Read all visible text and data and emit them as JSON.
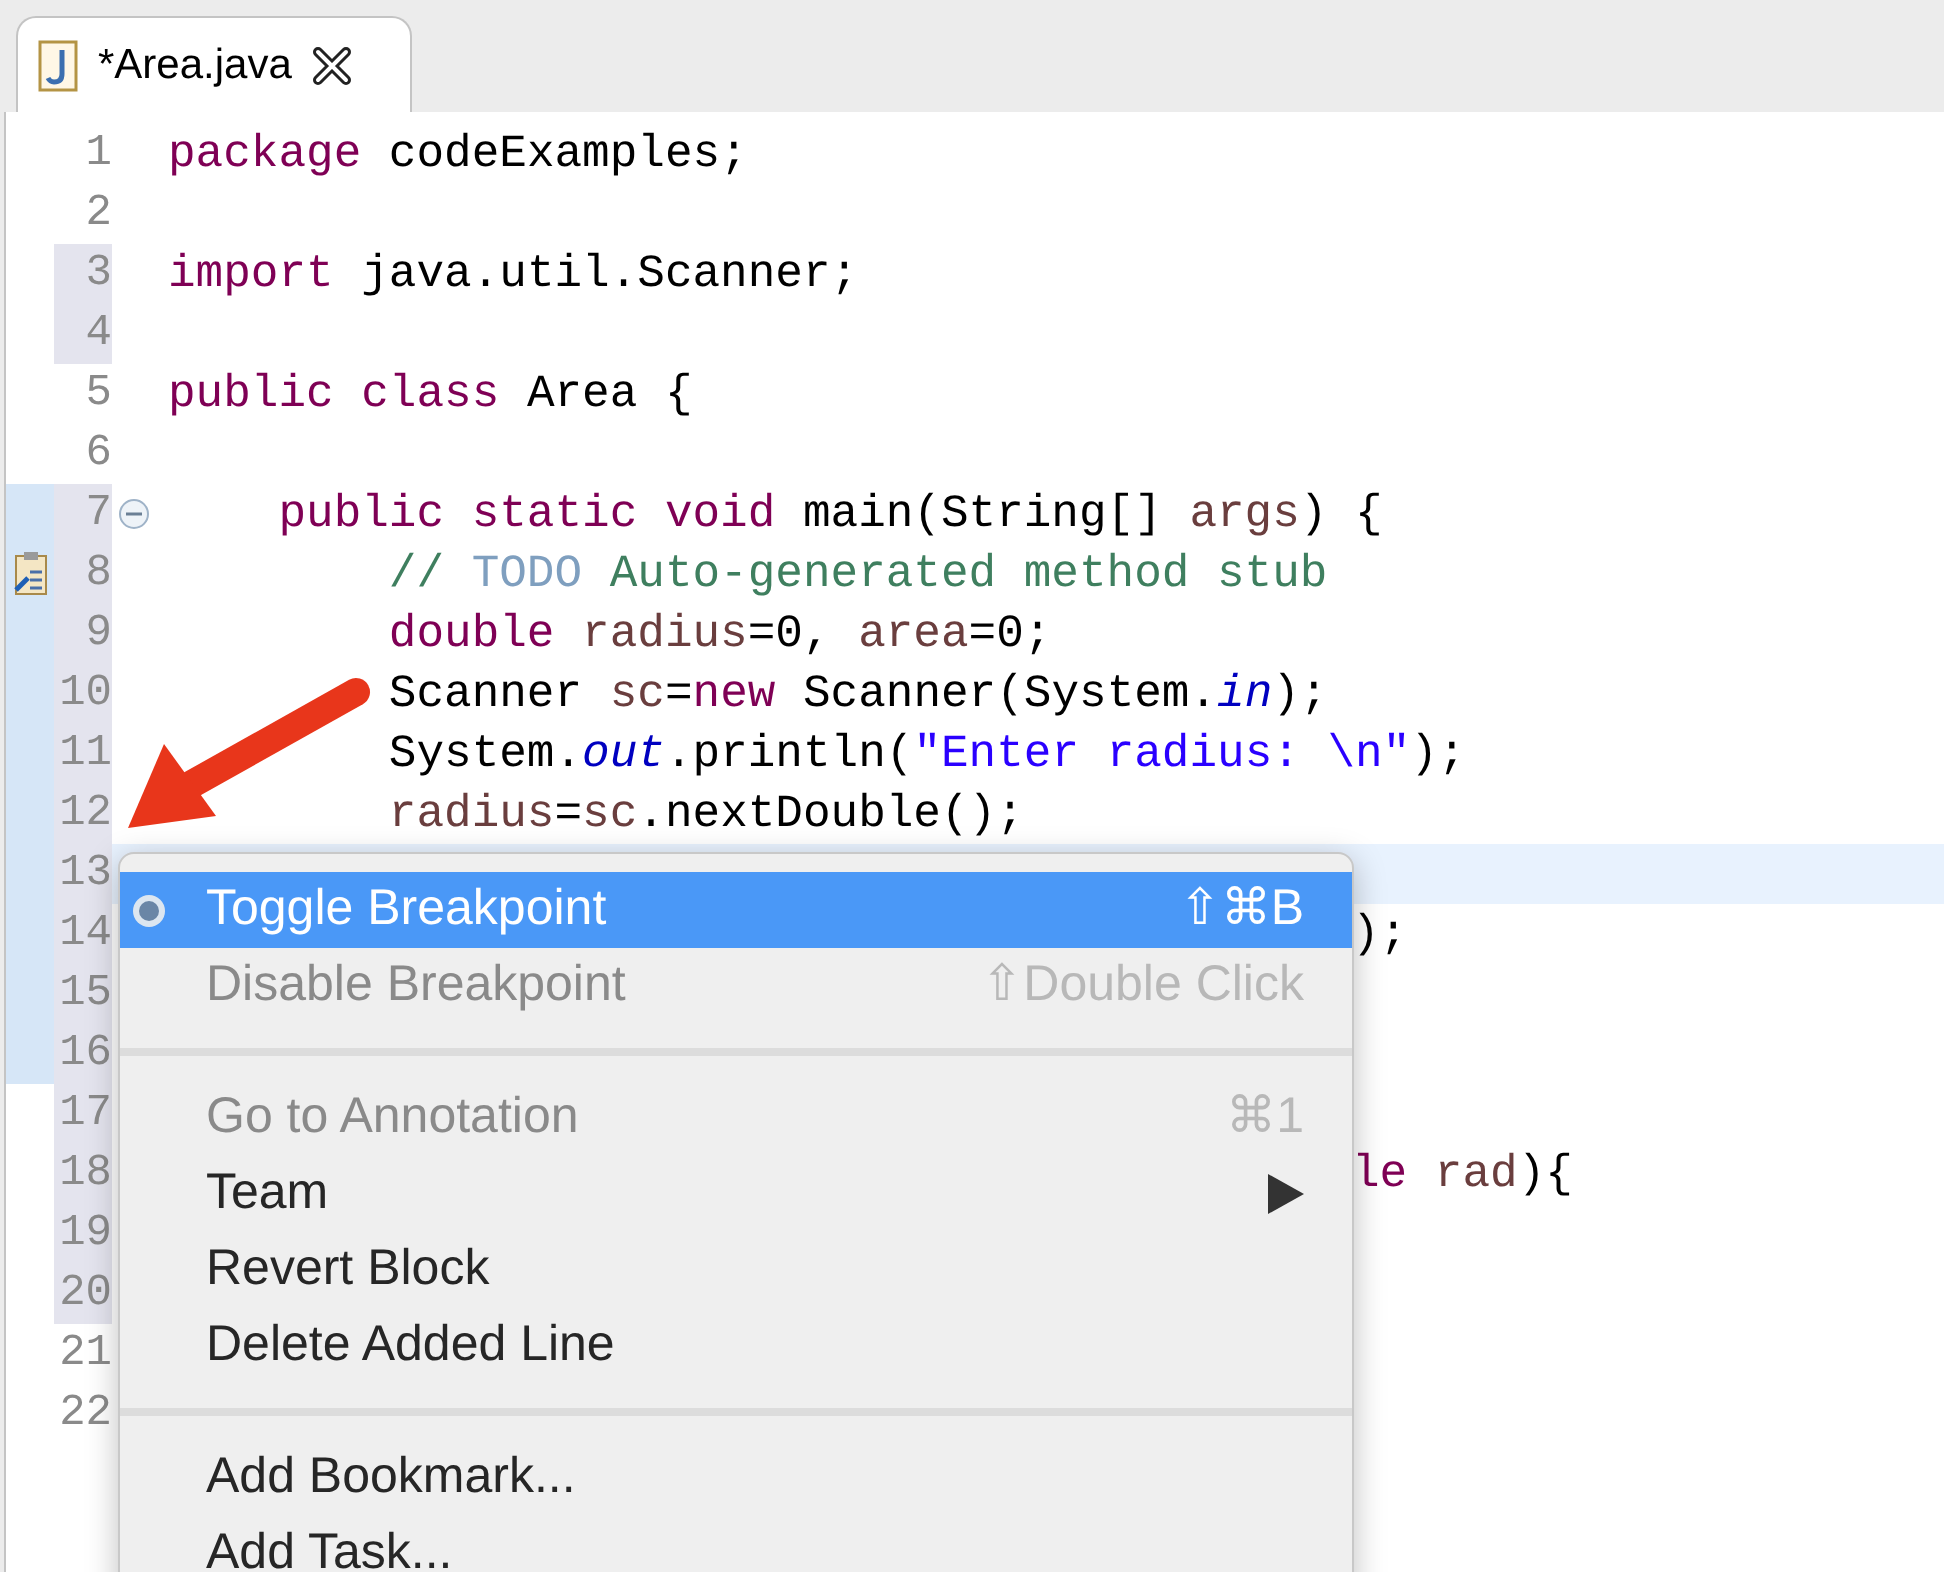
{
  "tab": {
    "title": "*Area.java",
    "selected": true
  },
  "editor": {
    "lines": [
      {
        "number": "1",
        "tokens": [
          {
            "kind": "keyword",
            "text": "package"
          },
          {
            "kind": "plain",
            "text": " codeExamples;"
          }
        ]
      },
      {
        "number": "2"
      },
      {
        "number": "3",
        "tokens": [
          {
            "kind": "keyword",
            "text": "import"
          },
          {
            "kind": "plain",
            "text": " java.util.Scanner;"
          }
        ]
      },
      {
        "number": "4"
      },
      {
        "number": "5",
        "tokens": [
          {
            "kind": "keyword",
            "text": "public class"
          },
          {
            "kind": "plain",
            "text": " Area {"
          }
        ]
      },
      {
        "number": "6"
      },
      {
        "number": "7",
        "fold": true,
        "tokens": [
          {
            "kind": "keyword",
            "text": "    public static void"
          },
          {
            "kind": "plain",
            "text": " main(String[] "
          },
          {
            "kind": "variable",
            "text": "args"
          },
          {
            "kind": "plain",
            "text": ") {"
          }
        ]
      },
      {
        "number": "8",
        "task": true,
        "tokens": [
          {
            "kind": "comment",
            "text": "        // "
          },
          {
            "kind": "todo",
            "text": "TODO"
          },
          {
            "kind": "comment",
            "text": " Auto-generated method stub"
          }
        ]
      },
      {
        "number": "9",
        "tokens": [
          {
            "kind": "keyword",
            "text": "        double"
          },
          {
            "kind": "variable",
            "text": " radius"
          },
          {
            "kind": "plain",
            "text": "=0, "
          },
          {
            "kind": "variable",
            "text": "area"
          },
          {
            "kind": "plain",
            "text": "=0;"
          }
        ]
      },
      {
        "number": "10",
        "tokens": [
          {
            "kind": "plain",
            "text": "        Scanner "
          },
          {
            "kind": "variable",
            "text": "sc"
          },
          {
            "kind": "plain",
            "text": "="
          },
          {
            "kind": "keyword",
            "text": "new"
          },
          {
            "kind": "plain",
            "text": " Scanner(System."
          },
          {
            "kind": "field",
            "text": "in"
          },
          {
            "kind": "plain",
            "text": ");"
          }
        ]
      },
      {
        "number": "11",
        "tokens": [
          {
            "kind": "plain",
            "text": "        System."
          },
          {
            "kind": "field",
            "text": "out"
          },
          {
            "kind": "plain",
            "text": ".println("
          },
          {
            "kind": "string",
            "text": "\"Enter radius: \\n\""
          },
          {
            "kind": "plain",
            "text": ");"
          }
        ]
      },
      {
        "number": "12",
        "tokens": [
          {
            "kind": "variable",
            "text": "        radius"
          },
          {
            "kind": "plain",
            "text": "="
          },
          {
            "kind": "variable",
            "text": "sc"
          },
          {
            "kind": "plain",
            "text": ".nextDouble();"
          }
        ]
      },
      {
        "number": "13",
        "current": true
      },
      {
        "number": "14",
        "behind_menu": true,
        "tokens": [
          {
            "kind": "plain",
            "text": ");"
          }
        ]
      },
      {
        "number": "15"
      },
      {
        "number": "16"
      },
      {
        "number": "17"
      },
      {
        "number": "18",
        "behind_menu": true,
        "tokens": [
          {
            "kind": "keyword",
            "text": "le"
          },
          {
            "kind": "variable",
            "text": " rad"
          },
          {
            "kind": "plain",
            "text": "){"
          }
        ]
      },
      {
        "number": "19"
      },
      {
        "number": "20"
      },
      {
        "number": "21"
      },
      {
        "number": "22"
      }
    ]
  },
  "context_menu": {
    "items": [
      {
        "kind": "item",
        "label": "Toggle Breakpoint",
        "shortcut": "⇧⌘B",
        "selected": true,
        "disabled": false,
        "breakpoint_icon": true
      },
      {
        "kind": "item",
        "label": "Disable Breakpoint",
        "shortcut": "⇧Double Click",
        "selected": false,
        "disabled": true
      },
      {
        "kind": "separator"
      },
      {
        "kind": "item",
        "label": "Go to Annotation",
        "shortcut": "⌘1",
        "selected": false,
        "disabled": true
      },
      {
        "kind": "item",
        "label": "Team",
        "submenu": true,
        "selected": false,
        "disabled": false
      },
      {
        "kind": "item",
        "label": "Revert Block",
        "selected": false,
        "disabled": false
      },
      {
        "kind": "item",
        "label": "Delete Added Line",
        "selected": false,
        "disabled": false
      },
      {
        "kind": "separator"
      },
      {
        "kind": "item",
        "label": "Add Bookmark...",
        "selected": false,
        "disabled": false
      },
      {
        "kind": "item",
        "label": "Add Task...",
        "selected": false,
        "disabled": false
      }
    ]
  }
}
